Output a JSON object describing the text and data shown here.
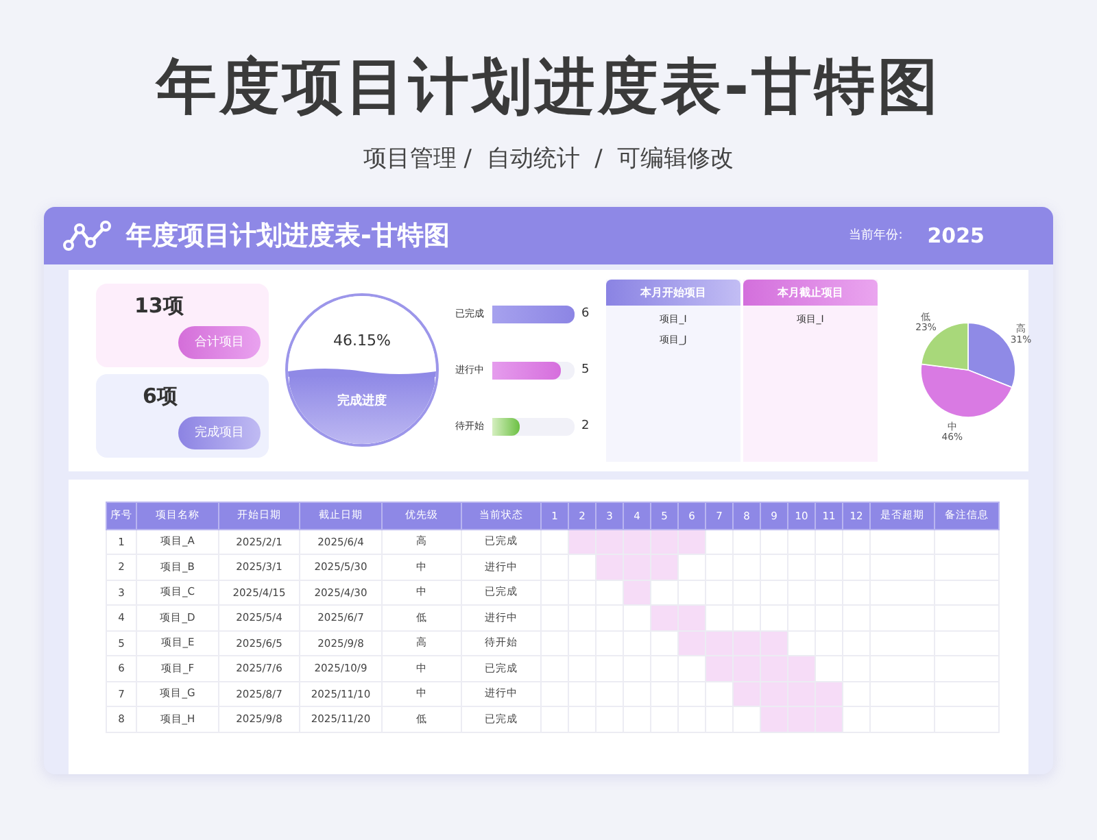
{
  "page_title": "年度项目计划进度表-甘特图",
  "subtitle": "项目管理 /  自动统计  /  可编辑修改",
  "header": {
    "title": "年度项目计划进度表-甘特图",
    "year_label": "当前年份:",
    "year": "2025"
  },
  "summary_cards": [
    {
      "value": "13项",
      "label": "合计项目",
      "kind": "pink"
    },
    {
      "value": "6项",
      "label": "完成项目",
      "kind": "purple"
    }
  ],
  "progress": {
    "reading": "46.15%",
    "label": "完成进度",
    "level": 0.4615
  },
  "status_bars": [
    {
      "label": "已完成",
      "count": "6",
      "level": 1,
      "kind": "purple"
    },
    {
      "label": "进行中",
      "count": "5",
      "level": 0.83,
      "kind": "pink"
    },
    {
      "label": "待开始",
      "count": "2",
      "level": 0.33,
      "kind": "green"
    }
  ],
  "month_lists": [
    {
      "title": "本月开始项目",
      "kind": "purple",
      "items": [
        "项目_I",
        "项目_J"
      ]
    },
    {
      "title": "本月截止项目",
      "kind": "pink",
      "items": [
        "项目_I"
      ]
    }
  ],
  "priority_chart": {
    "chart_data": {
      "type": "pie",
      "categories": [
        "高",
        "中",
        "低"
      ],
      "values": [
        31,
        46,
        23
      ],
      "value_labels": [
        "31%",
        "46%",
        "23%"
      ],
      "colors": [
        "#8f8ae6",
        "#d97ae3",
        "#a8d87a"
      ]
    }
  },
  "table": {
    "columns": [
      "序号",
      "项目名称",
      "开始日期",
      "截止日期",
      "优先级",
      "当前状态",
      "1",
      "2",
      "3",
      "4",
      "5",
      "6",
      "7",
      "8",
      "9",
      "10",
      "11",
      "12",
      "是否超期",
      "备注信息"
    ],
    "rows": [
      {
        "cells": [
          "1",
          "项目_A",
          "2025/2/1",
          "2025/6/4",
          "高",
          "已完成"
        ],
        "months": [
          false,
          true,
          true,
          true,
          true,
          true,
          false,
          false,
          false,
          false,
          false,
          false
        ]
      },
      {
        "cells": [
          "2",
          "项目_B",
          "2025/3/1",
          "2025/5/30",
          "中",
          "进行中"
        ],
        "months": [
          false,
          false,
          true,
          true,
          true,
          false,
          false,
          false,
          false,
          false,
          false,
          false
        ]
      },
      {
        "cells": [
          "3",
          "项目_C",
          "2025/4/15",
          "2025/4/30",
          "中",
          "已完成"
        ],
        "months": [
          false,
          false,
          false,
          true,
          false,
          false,
          false,
          false,
          false,
          false,
          false,
          false
        ]
      },
      {
        "cells": [
          "4",
          "项目_D",
          "2025/5/4",
          "2025/6/7",
          "低",
          "进行中"
        ],
        "months": [
          false,
          false,
          false,
          false,
          true,
          true,
          false,
          false,
          false,
          false,
          false,
          false
        ]
      },
      {
        "cells": [
          "5",
          "项目_E",
          "2025/6/5",
          "2025/9/8",
          "高",
          "待开始"
        ],
        "months": [
          false,
          false,
          false,
          false,
          false,
          true,
          true,
          true,
          true,
          false,
          false,
          false
        ]
      },
      {
        "cells": [
          "6",
          "项目_F",
          "2025/7/6",
          "2025/10/9",
          "中",
          "已完成"
        ],
        "months": [
          false,
          false,
          false,
          false,
          false,
          false,
          true,
          true,
          true,
          true,
          false,
          false
        ]
      },
      {
        "cells": [
          "7",
          "项目_G",
          "2025/8/7",
          "2025/11/10",
          "中",
          "进行中"
        ],
        "months": [
          false,
          false,
          false,
          false,
          false,
          false,
          false,
          true,
          true,
          true,
          true,
          false
        ]
      },
      {
        "cells": [
          "8",
          "项目_H",
          "2025/9/8",
          "2025/11/20",
          "低",
          "已完成"
        ],
        "months": [
          false,
          false,
          false,
          false,
          false,
          false,
          false,
          false,
          true,
          true,
          true,
          false
        ]
      }
    ]
  }
}
